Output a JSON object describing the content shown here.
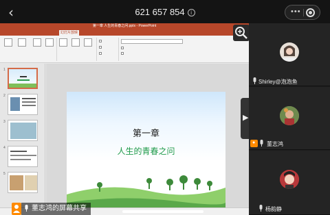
{
  "header": {
    "back_label": "‹",
    "meeting_id": "621 657 854",
    "info_glyph": "i",
    "more_glyph": "•••"
  },
  "ppt": {
    "window_title": "第一章 人生的青春之问.pptx - PowerPoint",
    "active_tab": "幻灯片放映",
    "slide_heading": "第一章",
    "slide_subtitle": "人生的青春之问"
  },
  "share_bar": {
    "sharer_label": "董志鸿的屏幕共享"
  },
  "participants": [
    {
      "name": "Shirley@泡泡鱼",
      "host": false
    },
    {
      "name": "董志鸿",
      "host": true
    },
    {
      "name": "杨韵静",
      "host": false
    }
  ],
  "colors": {
    "ppt_accent": "#b7472a",
    "host_badge": "#ff8a00",
    "slide_subtitle": "#1f9a4a"
  },
  "icons": {
    "back": "chevron-left-icon",
    "magnifier": "zoom-icon",
    "expander": "chevron-right-icon",
    "mic": "microphone-icon",
    "host": "host-icon"
  }
}
